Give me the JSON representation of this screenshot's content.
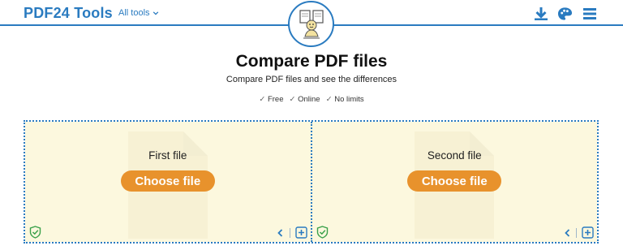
{
  "header": {
    "brand": "PDF24 Tools",
    "all_tools_label": "All tools",
    "icons": [
      "download-icon",
      "palette-icon",
      "menu-icon"
    ],
    "accent_color": "#2a7bc0"
  },
  "hero": {
    "title": "Compare PDF files",
    "subtitle": "Compare PDF files and see the differences",
    "features": [
      "Free",
      "Online",
      "No limits"
    ]
  },
  "zones": [
    {
      "label": "First file",
      "button": "Choose file"
    },
    {
      "label": "Second file",
      "button": "Choose file"
    }
  ],
  "colors": {
    "button": "#e8922c",
    "zone_background": "#fcf8de",
    "shield": "#3aa14a"
  }
}
